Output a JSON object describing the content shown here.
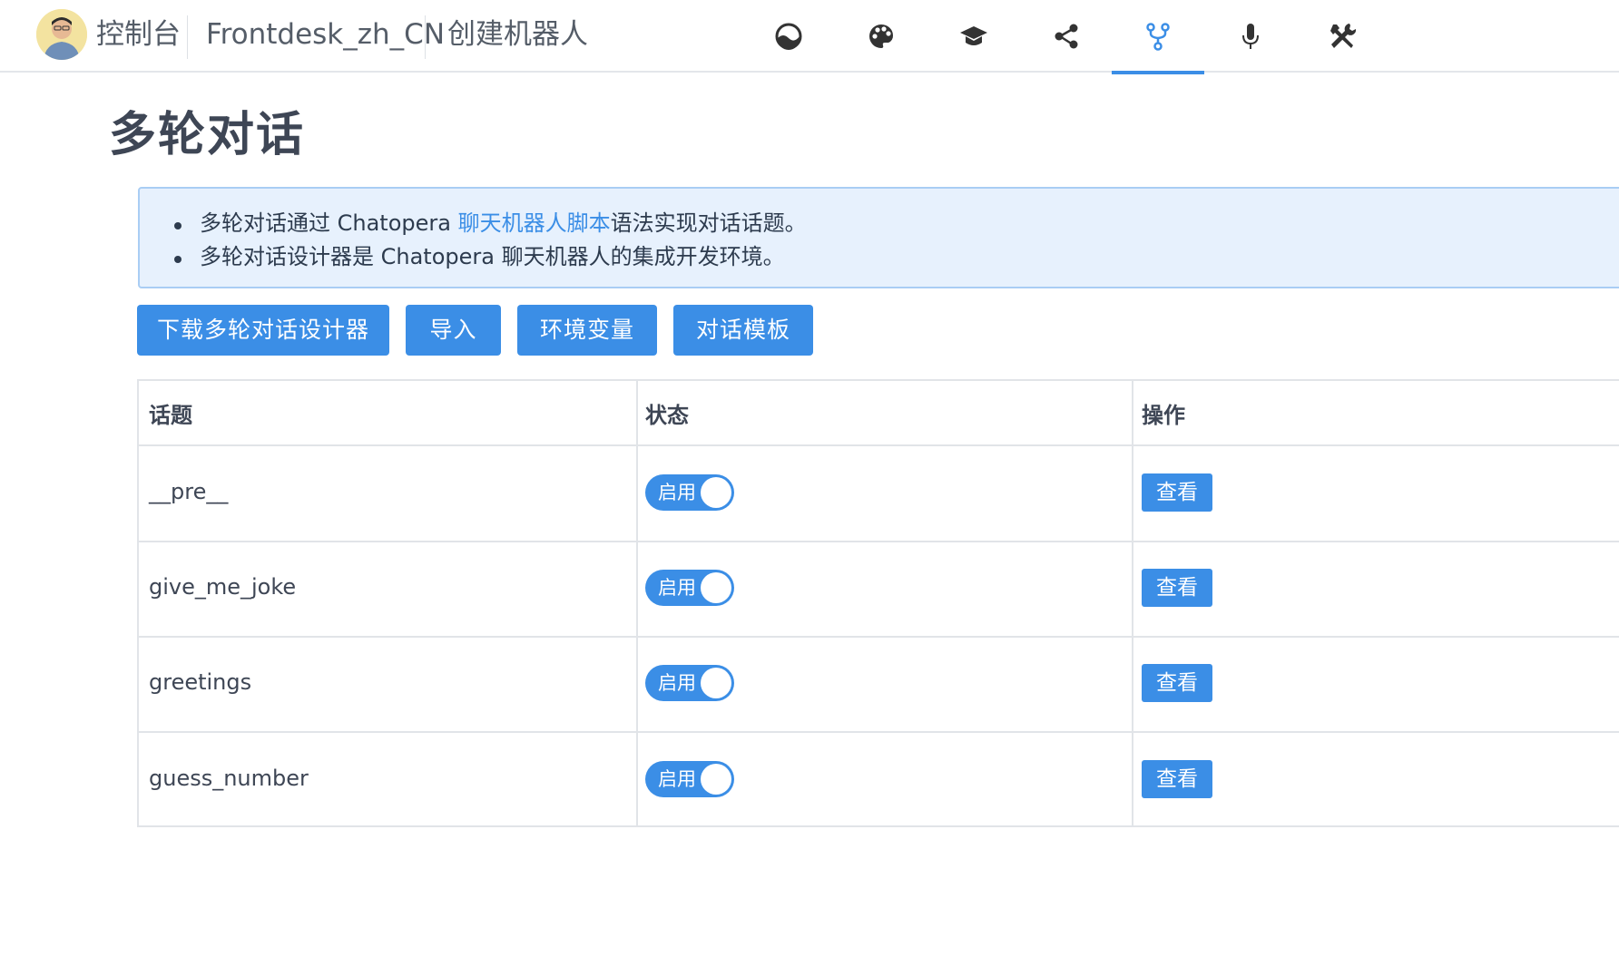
{
  "header": {
    "crumbs": [
      "控制台",
      "Frontdesk_zh_CN",
      "创建机器人"
    ],
    "nav_icons": [
      "dashboard-icon",
      "palette-icon",
      "graduation-cap-icon",
      "share-icon",
      "flow-fork-icon",
      "microphone-icon",
      "tools-icon"
    ],
    "active_icon": "flow-fork-icon",
    "accent": "#3b8ee6"
  },
  "page": {
    "title": "多轮对话"
  },
  "notice": {
    "line1_before": "多轮对话通过 Chatopera ",
    "line1_link": "聊天机器人脚本",
    "line1_after": "语法实现对话话题。",
    "line2": "多轮对话设计器是 Chatopera 聊天机器人的集成开发环境。"
  },
  "actions": {
    "download": "下载多轮对话设计器",
    "import": "导入",
    "env_vars": "环境变量",
    "templates": "对话模板"
  },
  "table": {
    "columns": [
      "话题",
      "状态",
      "操作"
    ],
    "rows": [
      {
        "topic": "__pre__",
        "status": "启用",
        "action": "查看"
      },
      {
        "topic": "give_me_joke",
        "status": "启用",
        "action": "查看"
      },
      {
        "topic": "greetings",
        "status": "启用",
        "action": "查看"
      },
      {
        "topic": "guess_number",
        "status": "启用",
        "action": "查看"
      }
    ]
  }
}
